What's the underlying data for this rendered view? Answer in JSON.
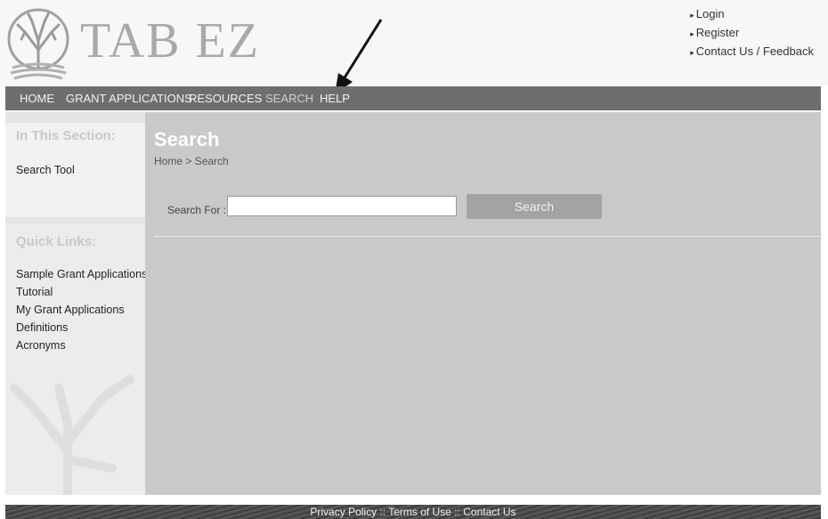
{
  "header": {
    "logo_text": "TAB EZ",
    "top_links": [
      "Login",
      "Register",
      "Contact Us / Feedback"
    ]
  },
  "nav": {
    "items": [
      "HOME",
      "GRANT APPLICATIONS",
      "RESOURCES",
      "SEARCH",
      "HELP"
    ]
  },
  "sidebar": {
    "section_heading": "In This Section:",
    "section_items": [
      "Search Tool"
    ],
    "quick_links_heading": "Quick Links:",
    "quick_links": [
      "Sample Grant Applications",
      "Tutorial",
      "My Grant Applications",
      "Definitions",
      "Acronyms"
    ]
  },
  "main": {
    "title": "Search",
    "breadcrumb": "Home > Search",
    "search_label": "Search For :",
    "search_value": "",
    "search_button": "Search"
  },
  "footer": {
    "links": [
      "Privacy Policy",
      "Terms of Use",
      "Contact Us"
    ],
    "separator": " :: "
  },
  "colors": {
    "nav_bg": "#6e6e6e",
    "main_bg": "#c9c9c9",
    "sidebar_bg": "#e4e4e4",
    "button_bg": "#a3a3a3"
  }
}
